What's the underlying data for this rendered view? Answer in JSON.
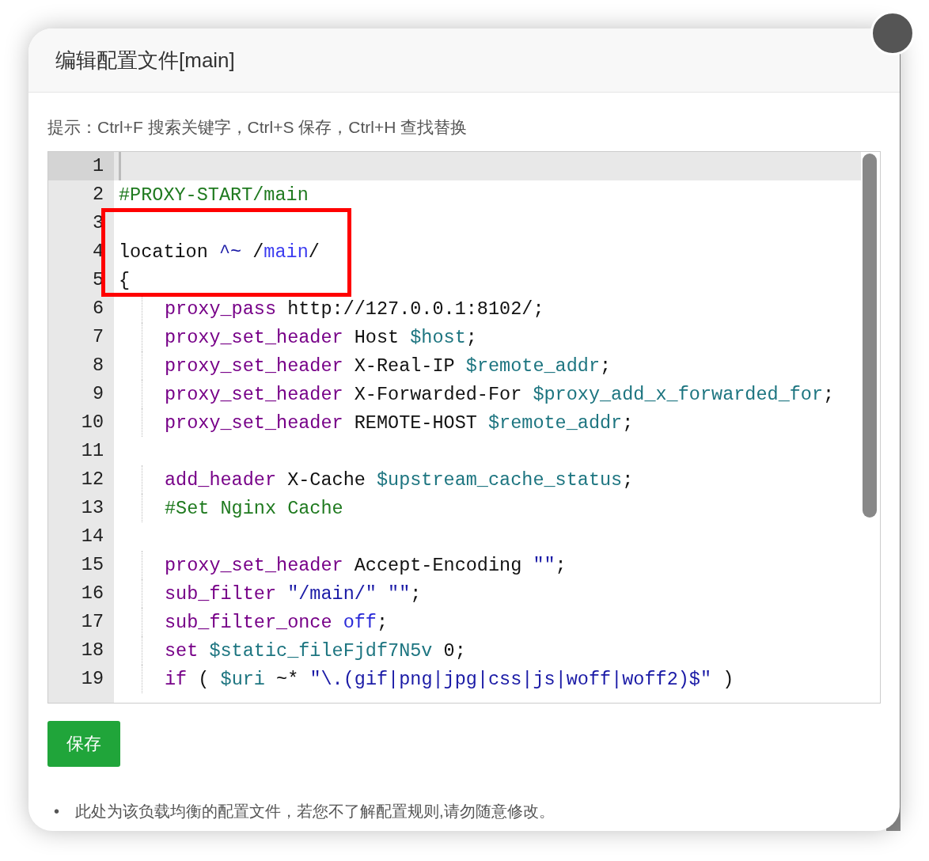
{
  "dialog": {
    "title": "编辑配置文件[main]"
  },
  "hint": "提示：Ctrl+F 搜索关键字，Ctrl+S 保存，Ctrl+H 查找替换",
  "editor": {
    "lines": [
      {
        "number": "1",
        "active": true,
        "indent": false
      },
      {
        "number": "2",
        "active": false,
        "indent": false,
        "tokens": [
          {
            "kind": "comment",
            "text": "#PROXY-START/main"
          }
        ]
      },
      {
        "number": "3",
        "active": false,
        "indent": false
      },
      {
        "number": "4",
        "active": false,
        "indent": false,
        "tokens": [
          {
            "kind": "plain",
            "text": "location "
          },
          {
            "kind": "operator",
            "text": "^~"
          },
          {
            "kind": "plain",
            "text": " /"
          },
          {
            "kind": "path",
            "text": "main"
          },
          {
            "kind": "plain",
            "text": "/"
          }
        ]
      },
      {
        "number": "5",
        "active": false,
        "indent": false,
        "tokens": [
          {
            "kind": "plain",
            "text": "{"
          }
        ]
      },
      {
        "number": "6",
        "active": false,
        "indent": true,
        "tokens": [
          {
            "kind": "keyword",
            "text": "proxy_pass"
          },
          {
            "kind": "plain",
            "text": " http://127.0.0.1:8102/;"
          }
        ]
      },
      {
        "number": "7",
        "active": false,
        "indent": true,
        "tokens": [
          {
            "kind": "keyword",
            "text": "proxy_set_header"
          },
          {
            "kind": "plain",
            "text": " Host "
          },
          {
            "kind": "variable",
            "text": "$host"
          },
          {
            "kind": "plain",
            "text": ";"
          }
        ]
      },
      {
        "number": "8",
        "active": false,
        "indent": true,
        "tokens": [
          {
            "kind": "keyword",
            "text": "proxy_set_header"
          },
          {
            "kind": "plain",
            "text": " X-Real-IP "
          },
          {
            "kind": "variable",
            "text": "$remote_addr"
          },
          {
            "kind": "plain",
            "text": ";"
          }
        ]
      },
      {
        "number": "9",
        "active": false,
        "indent": true,
        "tokens": [
          {
            "kind": "keyword",
            "text": "proxy_set_header"
          },
          {
            "kind": "plain",
            "text": " X-Forwarded-For "
          },
          {
            "kind": "variable",
            "text": "$proxy_add_x_forwarded_for"
          },
          {
            "kind": "plain",
            "text": ";"
          }
        ]
      },
      {
        "number": "10",
        "active": false,
        "indent": true,
        "tokens": [
          {
            "kind": "keyword",
            "text": "proxy_set_header"
          },
          {
            "kind": "plain",
            "text": " REMOTE-HOST "
          },
          {
            "kind": "variable",
            "text": "$remote_addr"
          },
          {
            "kind": "plain",
            "text": ";"
          }
        ]
      },
      {
        "number": "11",
        "active": false,
        "indent": false
      },
      {
        "number": "12",
        "active": false,
        "indent": true,
        "tokens": [
          {
            "kind": "keyword",
            "text": "add_header"
          },
          {
            "kind": "plain",
            "text": " X-Cache "
          },
          {
            "kind": "variable",
            "text": "$upstream_cache_status"
          },
          {
            "kind": "plain",
            "text": ";"
          }
        ]
      },
      {
        "number": "13",
        "active": false,
        "indent": true,
        "tokens": [
          {
            "kind": "comment",
            "text": "#Set Nginx Cache"
          }
        ]
      },
      {
        "number": "14",
        "active": false,
        "indent": false
      },
      {
        "number": "15",
        "active": false,
        "indent": true,
        "tokens": [
          {
            "kind": "keyword",
            "text": "proxy_set_header"
          },
          {
            "kind": "plain",
            "text": " Accept-Encoding "
          },
          {
            "kind": "string",
            "text": "\"\""
          },
          {
            "kind": "plain",
            "text": ";"
          }
        ]
      },
      {
        "number": "16",
        "active": false,
        "indent": true,
        "tokens": [
          {
            "kind": "keyword",
            "text": "sub_filter"
          },
          {
            "kind": "string",
            "text": " \"/main/\" \"\""
          },
          {
            "kind": "plain",
            "text": ";"
          }
        ]
      },
      {
        "number": "17",
        "active": false,
        "indent": true,
        "tokens": [
          {
            "kind": "keyword",
            "text": "sub_filter_once"
          },
          {
            "kind": "atom",
            "text": " off"
          },
          {
            "kind": "plain",
            "text": ";"
          }
        ]
      },
      {
        "number": "18",
        "active": false,
        "indent": true,
        "tokens": [
          {
            "kind": "keyword",
            "text": "set"
          },
          {
            "kind": "variable",
            "text": " $static_fileFjdf7N5v"
          },
          {
            "kind": "plain",
            "text": " 0;"
          }
        ]
      },
      {
        "number": "19",
        "active": false,
        "indent": true,
        "tokens": [
          {
            "kind": "keyword",
            "text": "if"
          },
          {
            "kind": "plain",
            "text": " ( "
          },
          {
            "kind": "variable",
            "text": "$uri"
          },
          {
            "kind": "plain",
            "text": " ~* "
          },
          {
            "kind": "string",
            "text": "\"\\.(gif|png|jpg|css|js|woff|woff2)$\""
          },
          {
            "kind": "plain",
            "text": " )"
          }
        ]
      }
    ]
  },
  "save_button": "保存",
  "notes": [
    {
      "bullet": "•",
      "text": "此处为该负载均衡的配置文件，若您不了解配置规则,请勿随意修改。"
    }
  ]
}
